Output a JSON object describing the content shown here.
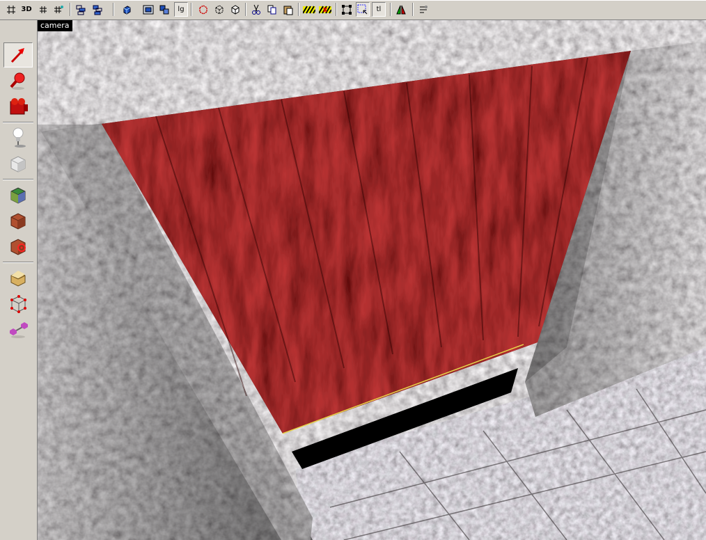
{
  "toolbar": {
    "buttons": [
      {
        "name": "grid-toggle-icon"
      },
      {
        "name": "view-3d-icon",
        "label": "3D"
      },
      {
        "name": "grid-small-icon"
      },
      {
        "name": "grid-snap-icon"
      },
      {
        "name": "group-icon"
      },
      {
        "name": "ungroup-icon"
      },
      {
        "name": "cube-blue-icon"
      },
      {
        "name": "camera-view-icon"
      },
      {
        "name": "texture-view-icon"
      },
      {
        "name": "texture-lock-icon",
        "label": "lg"
      },
      {
        "name": "brush-red-icon"
      },
      {
        "name": "brush-outline-icon"
      },
      {
        "name": "brush-solid-icon"
      },
      {
        "name": "cut-icon"
      },
      {
        "name": "copy-icon"
      },
      {
        "name": "paste-icon"
      },
      {
        "name": "hazard-stripe-icon"
      },
      {
        "name": "hazard-red-icon"
      },
      {
        "name": "vertex-edit-icon"
      },
      {
        "name": "select-region-icon"
      },
      {
        "name": "text-tool-icon",
        "label": "tl"
      },
      {
        "name": "flip-icon"
      },
      {
        "name": "settings-icon"
      }
    ]
  },
  "toolbox": {
    "tools": [
      {
        "name": "select-arrow-tool-icon"
      },
      {
        "name": "magnify-tool-icon"
      },
      {
        "name": "camera-tool-icon"
      },
      {
        "name": "light-entity-tool-icon"
      },
      {
        "name": "block-tool-icon"
      },
      {
        "name": "texture-apply-tool-icon"
      },
      {
        "name": "brick-texture-tool-icon"
      },
      {
        "name": "decal-tool-icon"
      },
      {
        "name": "clip-tool-icon"
      },
      {
        "name": "vertex-manipulation-tool-icon"
      },
      {
        "name": "path-tool-icon"
      }
    ]
  },
  "viewport": {
    "label": "camera"
  },
  "colors": {
    "wall_red": "#5a0a0a",
    "stone": "#6a6468",
    "floor": "#7a7072",
    "highlight_edge": "#e6d24a"
  }
}
